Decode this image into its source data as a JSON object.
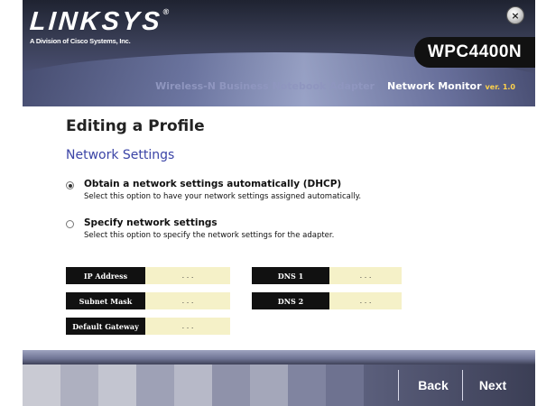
{
  "header": {
    "brand": "LINKSYS",
    "brand_mark": "®",
    "division": "A Division of Cisco Systems, Inc.",
    "model": "WPC4400N",
    "product_name": "Wireless-N Business Notebook Adapter",
    "app_name": "Network Monitor",
    "version": "ver. 1.0",
    "close_icon": "close-icon",
    "close_glyph": "×"
  },
  "content": {
    "page_title": "Editing a Profile",
    "section_title": "Network Settings",
    "options": [
      {
        "label": "Obtain a network settings automatically (DHCP)",
        "description": "Select this option to have your network settings assigned automatically.",
        "selected": true
      },
      {
        "label": "Specify network settings",
        "description": "Select this option to specify the network settings for the adapter.",
        "selected": false
      }
    ],
    "fields": {
      "ip_address": {
        "label": "IP Address",
        "value": ". . ."
      },
      "subnet_mask": {
        "label": "Subnet Mask",
        "value": ". . ."
      },
      "default_gateway": {
        "label": "Default Gateway",
        "value": ". . ."
      },
      "dns1": {
        "label": "DNS 1",
        "value": ". . ."
      },
      "dns2": {
        "label": "DNS 2",
        "value": ". . ."
      }
    }
  },
  "footer": {
    "back_label": "Back",
    "next_label": "Next"
  },
  "colors": {
    "accent_title": "#3b44a6",
    "field_label_bg": "#111111",
    "field_input_bg": "#f5f1c8",
    "header_dark": "#1f2331"
  }
}
